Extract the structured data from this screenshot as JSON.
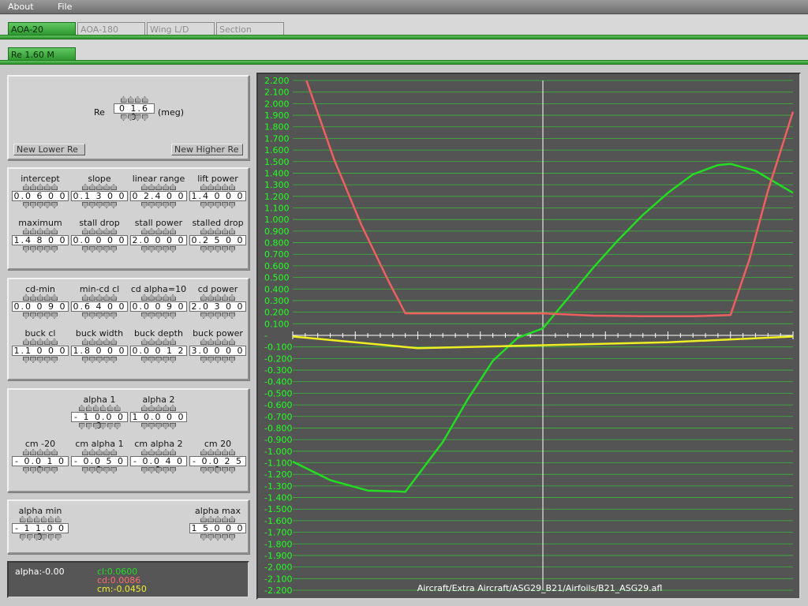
{
  "menu": {
    "about": "About",
    "file": "File"
  },
  "tabs": [
    "AOA-20",
    "AOA-180",
    "Wing L/D",
    "Section"
  ],
  "subtabs": [
    "Re 1.60 M"
  ],
  "re_panel": {
    "label": "Re",
    "value": "0 1.6 0",
    "unit": "(meg)",
    "lower_button": "New Lower Re",
    "higher_button": "New Higher Re"
  },
  "lift_panel": {
    "fields": [
      {
        "label": "intercept",
        "value": "0.0 6 0 0"
      },
      {
        "label": "slope",
        "value": "0.1 3 0 0"
      },
      {
        "label": "linear range",
        "value": "0 2.4 0 0"
      },
      {
        "label": "lift power",
        "value": "1.4 0 0 0"
      },
      {
        "label": "maximum",
        "value": "1.4 8 0 0"
      },
      {
        "label": "stall drop",
        "value": "0.0 0 0 0"
      },
      {
        "label": "stall power",
        "value": "2.0 0 0 0"
      },
      {
        "label": "stalled drop",
        "value": "0.2 5 0 0"
      }
    ]
  },
  "drag_panel": {
    "fields": [
      {
        "label": "cd-min",
        "value": "0.0 0 9 0"
      },
      {
        "label": "min-cd cl",
        "value": "0.6 4 0 0"
      },
      {
        "label": "cd alpha=10",
        "value": "0.0 0 9 0"
      },
      {
        "label": "cd power",
        "value": "2.0 3 0 0"
      },
      {
        "label": "buck cl",
        "value": "1.1 0 0 0"
      },
      {
        "label": "buck width",
        "value": "1.8 0 0 0"
      },
      {
        "label": "buck depth",
        "value": "0.0 0 1 2"
      },
      {
        "label": "buck power",
        "value": "3.0 0 0 0"
      }
    ]
  },
  "moment_panel": {
    "fields": [
      {
        "label": "alpha 1",
        "value": "- 1 0.0 0 0"
      },
      {
        "label": "alpha 2",
        "value": "1 0.0 0 0"
      },
      {
        "label": "cm -20",
        "value": "- 0.0 1 0 0"
      },
      {
        "label": "cm alpha 1",
        "value": "- 0.0 5 0 0"
      },
      {
        "label": "cm alpha 2",
        "value": "- 0.0 4 0 0"
      },
      {
        "label": "cm 20",
        "value": "- 0.0 2 5 0"
      }
    ]
  },
  "range_panel": {
    "fields": [
      {
        "label": "alpha min",
        "value": "- 1 1.0 0 0"
      },
      {
        "label": "alpha max",
        "value": "1 5.0 0 0"
      }
    ]
  },
  "readout": {
    "alpha": "alpha:-0.00",
    "cl": "cl:0.0600",
    "cd": "cd:0.0086",
    "cm": "cm:-0.0450"
  },
  "colors": {
    "cl": "#22dd22",
    "cd": "#ee6060",
    "cm": "#eeee22",
    "grid": "#3bb83b",
    "tick_label": "#22ff22"
  },
  "chart_data": {
    "type": "line",
    "ylim": [
      -2.2,
      2.2
    ],
    "xlim": [
      -20,
      20
    ],
    "y_ticks": [
      "2.200",
      "2.100",
      "2.000",
      "1.900",
      "1.800",
      "1.700",
      "1.600",
      "1.500",
      "1.400",
      "1.300",
      "1.200",
      "1.100",
      "1.000",
      "0.900",
      "0.800",
      "0.700",
      "0.600",
      "0.500",
      "0.400",
      "0.300",
      "0.200",
      "0.100",
      "-",
      "-0.100",
      "-0.200",
      "-0.300",
      "-0.400",
      "-0.500",
      "-0.600",
      "-0.700",
      "-0.800",
      "-0.900",
      "-1.000",
      "-1.100",
      "-1.200",
      "-1.300",
      "-1.400",
      "-1.500",
      "-1.600",
      "-1.700",
      "-1.800",
      "-1.900",
      "-2.000",
      "-2.100",
      "-2.200"
    ],
    "series": [
      {
        "key": "cl",
        "x": [
          -20,
          -17,
          -14,
          -11,
          -8,
          -6,
          -4,
          -2,
          0,
          2,
          4,
          6,
          8,
          10,
          12,
          14,
          15,
          17,
          20
        ],
        "y": [
          -1.09,
          -1.25,
          -1.34,
          -1.35,
          -0.92,
          -0.55,
          -0.22,
          -0.02,
          0.06,
          0.32,
          0.58,
          0.82,
          1.04,
          1.23,
          1.39,
          1.47,
          1.48,
          1.42,
          1.23
        ]
      },
      {
        "key": "cd",
        "x": [
          -18.9,
          -16.7,
          -14.5,
          -12.4,
          -11.0,
          -8,
          -4,
          0,
          4,
          8,
          12,
          15.0,
          16.5,
          18.0,
          20
        ],
        "y": [
          2.2,
          1.52,
          0.95,
          0.48,
          0.19,
          0.19,
          0.19,
          0.19,
          0.17,
          0.165,
          0.165,
          0.175,
          0.65,
          1.25,
          1.93
        ]
      },
      {
        "key": "cm",
        "x": [
          -20,
          -10,
          10,
          20
        ],
        "y": [
          -0.01,
          -0.11,
          -0.06,
          -0.01
        ]
      }
    ],
    "annotation": "Aircraft/Extra Aircraft/ASG29_B21/Airfoils/B21_ASG29.afl"
  }
}
